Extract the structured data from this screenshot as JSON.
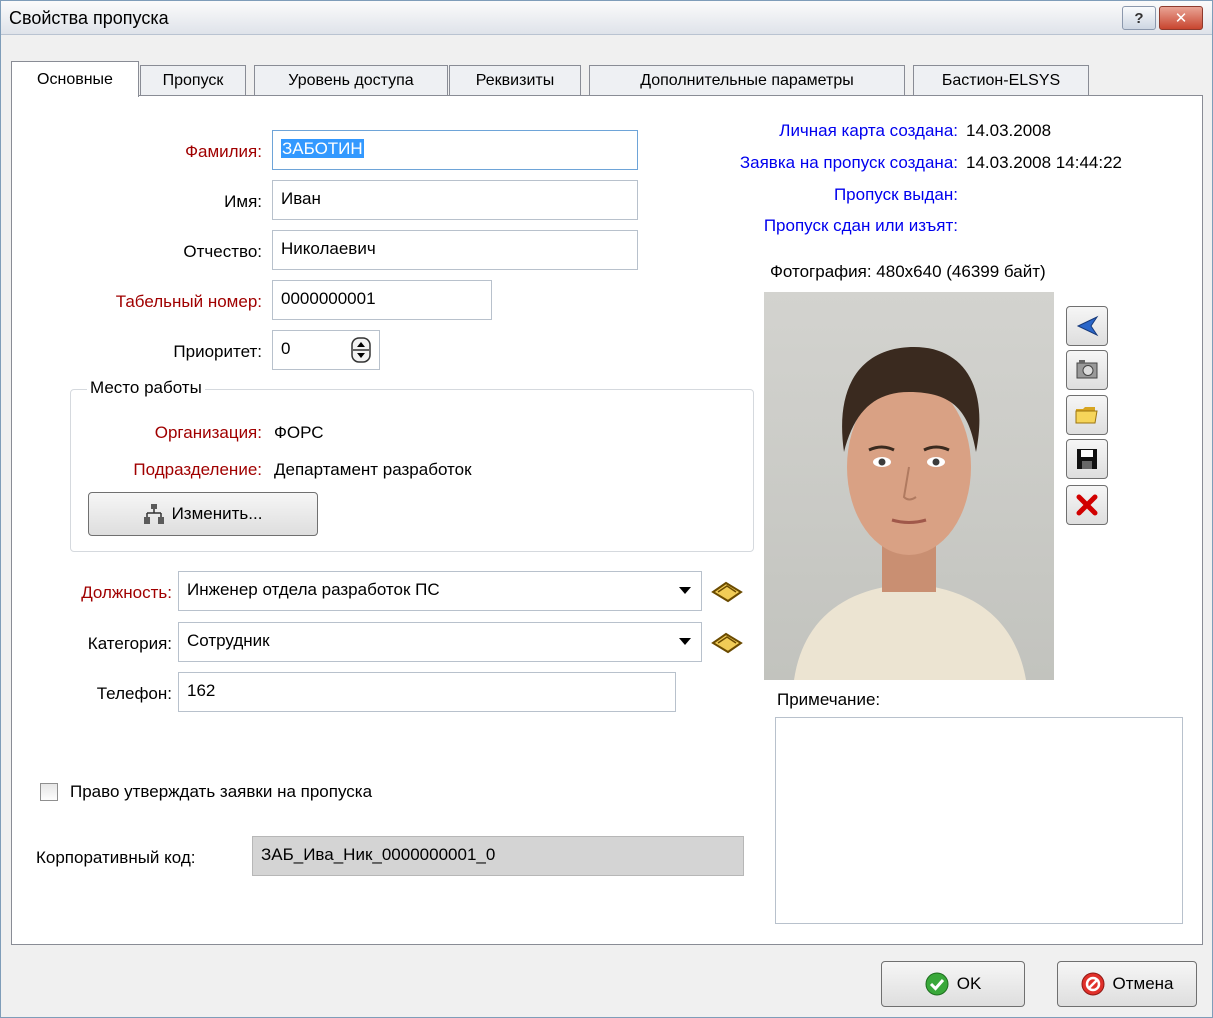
{
  "window": {
    "title": "Свойства пропуска",
    "help_label": "?",
    "close_label": "✕"
  },
  "tabs": [
    {
      "label": "Основные",
      "active": true
    },
    {
      "label": "Пропуск"
    },
    {
      "label": "Уровень доступа"
    },
    {
      "label": "Реквизиты"
    },
    {
      "label": "Дополнительные параметры"
    },
    {
      "label": "Бастион-ELSYS"
    }
  ],
  "form": {
    "surname_label": "Фамилия:",
    "surname_value": "ЗАБОТИН",
    "name_label": "Имя:",
    "name_value": "Иван",
    "patronymic_label": "Отчество:",
    "patronymic_value": "Николаевич",
    "personnel_label": "Табельный номер:",
    "personnel_value": "0000000001",
    "priority_label": "Приоритет:",
    "priority_value": "0",
    "workplace_title": "Место работы",
    "org_label": "Организация:",
    "org_value": "ФОРС",
    "dept_label": "Подразделение:",
    "dept_value": "Департамент разработок",
    "change_button": "Изменить...",
    "position_label": "Должность:",
    "position_value": "Инженер отдела разработок ПС",
    "category_label": "Категория:",
    "category_value": "Сотрудник",
    "phone_label": "Телефон:",
    "phone_value": "162",
    "approve_checkbox_label": "Право утверждать заявки на пропуска",
    "approve_checked": false,
    "corp_code_label": "Корпоративный код:",
    "corp_code_value": "ЗАБ_Ива_Ник_0000000001_0"
  },
  "info": {
    "card_created_label": "Личная карта создана:",
    "card_created_value": "14.03.2008",
    "request_created_label": "Заявка на пропуск создана:",
    "request_created_value": "14.03.2008 14:44:22",
    "pass_issued_label": "Пропуск выдан:",
    "pass_returned_label": "Пропуск сдан или изъят:"
  },
  "photo": {
    "caption": "Фотография: 480x640 (46399 байт)"
  },
  "notes": {
    "label": "Примечание:",
    "value": ""
  },
  "footer": {
    "ok_label": "OK",
    "cancel_label": "Отмена"
  },
  "colors": {
    "required_label": "#a00000",
    "info_label": "#0000ee",
    "selection": "#3399ff"
  }
}
